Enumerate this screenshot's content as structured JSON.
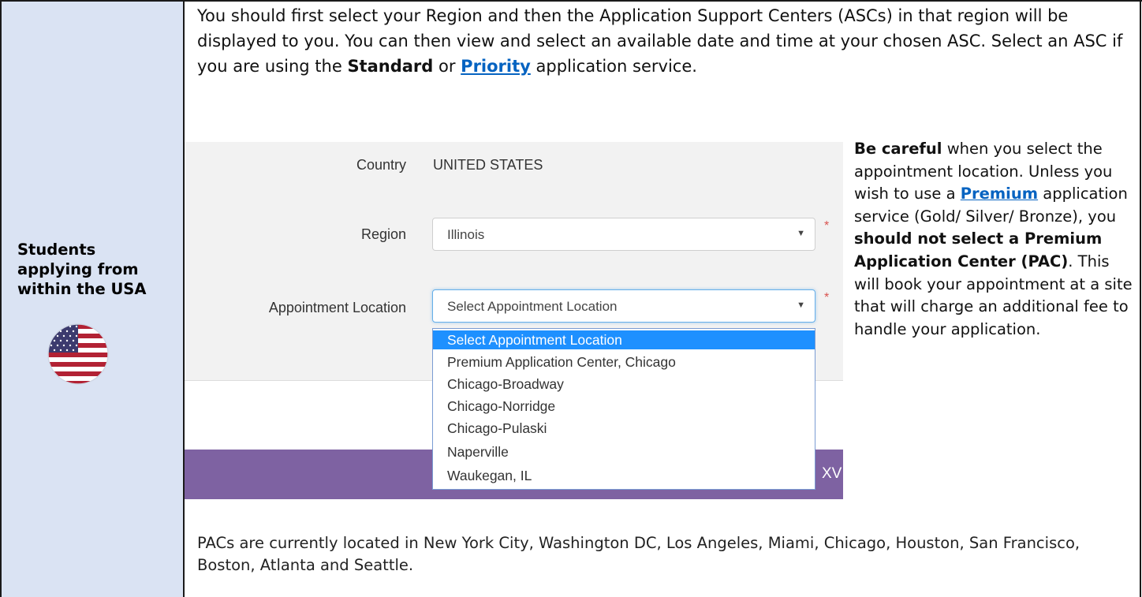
{
  "left_column": {
    "label_lines": [
      "Students",
      "applying from",
      "within the USA"
    ],
    "flag_icon": "us-flag-icon"
  },
  "intro": {
    "text_a": "You should first select your Region and then the Application Support Centers (ASCs) in that region will be displayed to you. You can then view and select an available date and time at your chosen ASC. Select an ASC if you are using the ",
    "bold_standard": "Standard",
    "text_or": " or ",
    "link_priority": "Priority",
    "text_b": " application service."
  },
  "form": {
    "country_label": "Country",
    "country_value": "UNITED STATES",
    "region_label": "Region",
    "region_value": "Illinois",
    "location_label": "Appointment Location",
    "location_value": "Select Appointment Location",
    "required_mark": "*",
    "dropdown_options": [
      "Select Appointment Location",
      "Premium Application Center, Chicago",
      "Chicago-Broadway",
      "Chicago-Norridge",
      "Chicago-Pulaski",
      "Naperville",
      "Waukegan, IL"
    ],
    "footer_fragment": "XVI",
    "accent_color": "#7e62a2",
    "highlight_color": "#1e90ff"
  },
  "note": {
    "bold_careful": "Be careful",
    "text_1": " when you select the appointment location. Unless you wish to use a ",
    "link_premium": "Premium",
    "text_2": " application service (Gold/ Silver/ Bronze), you ",
    "bold_warning": "should not select a Premium Application Center (PAC)",
    "text_3": ". This will book your appointment at a site that will charge an additional fee to handle your application."
  },
  "outro": {
    "text": "PACs are currently located in New York City, Washington DC, Los Angeles, Miami, Chicago, Houston, San Francisco, Boston, Atlanta and Seattle."
  }
}
